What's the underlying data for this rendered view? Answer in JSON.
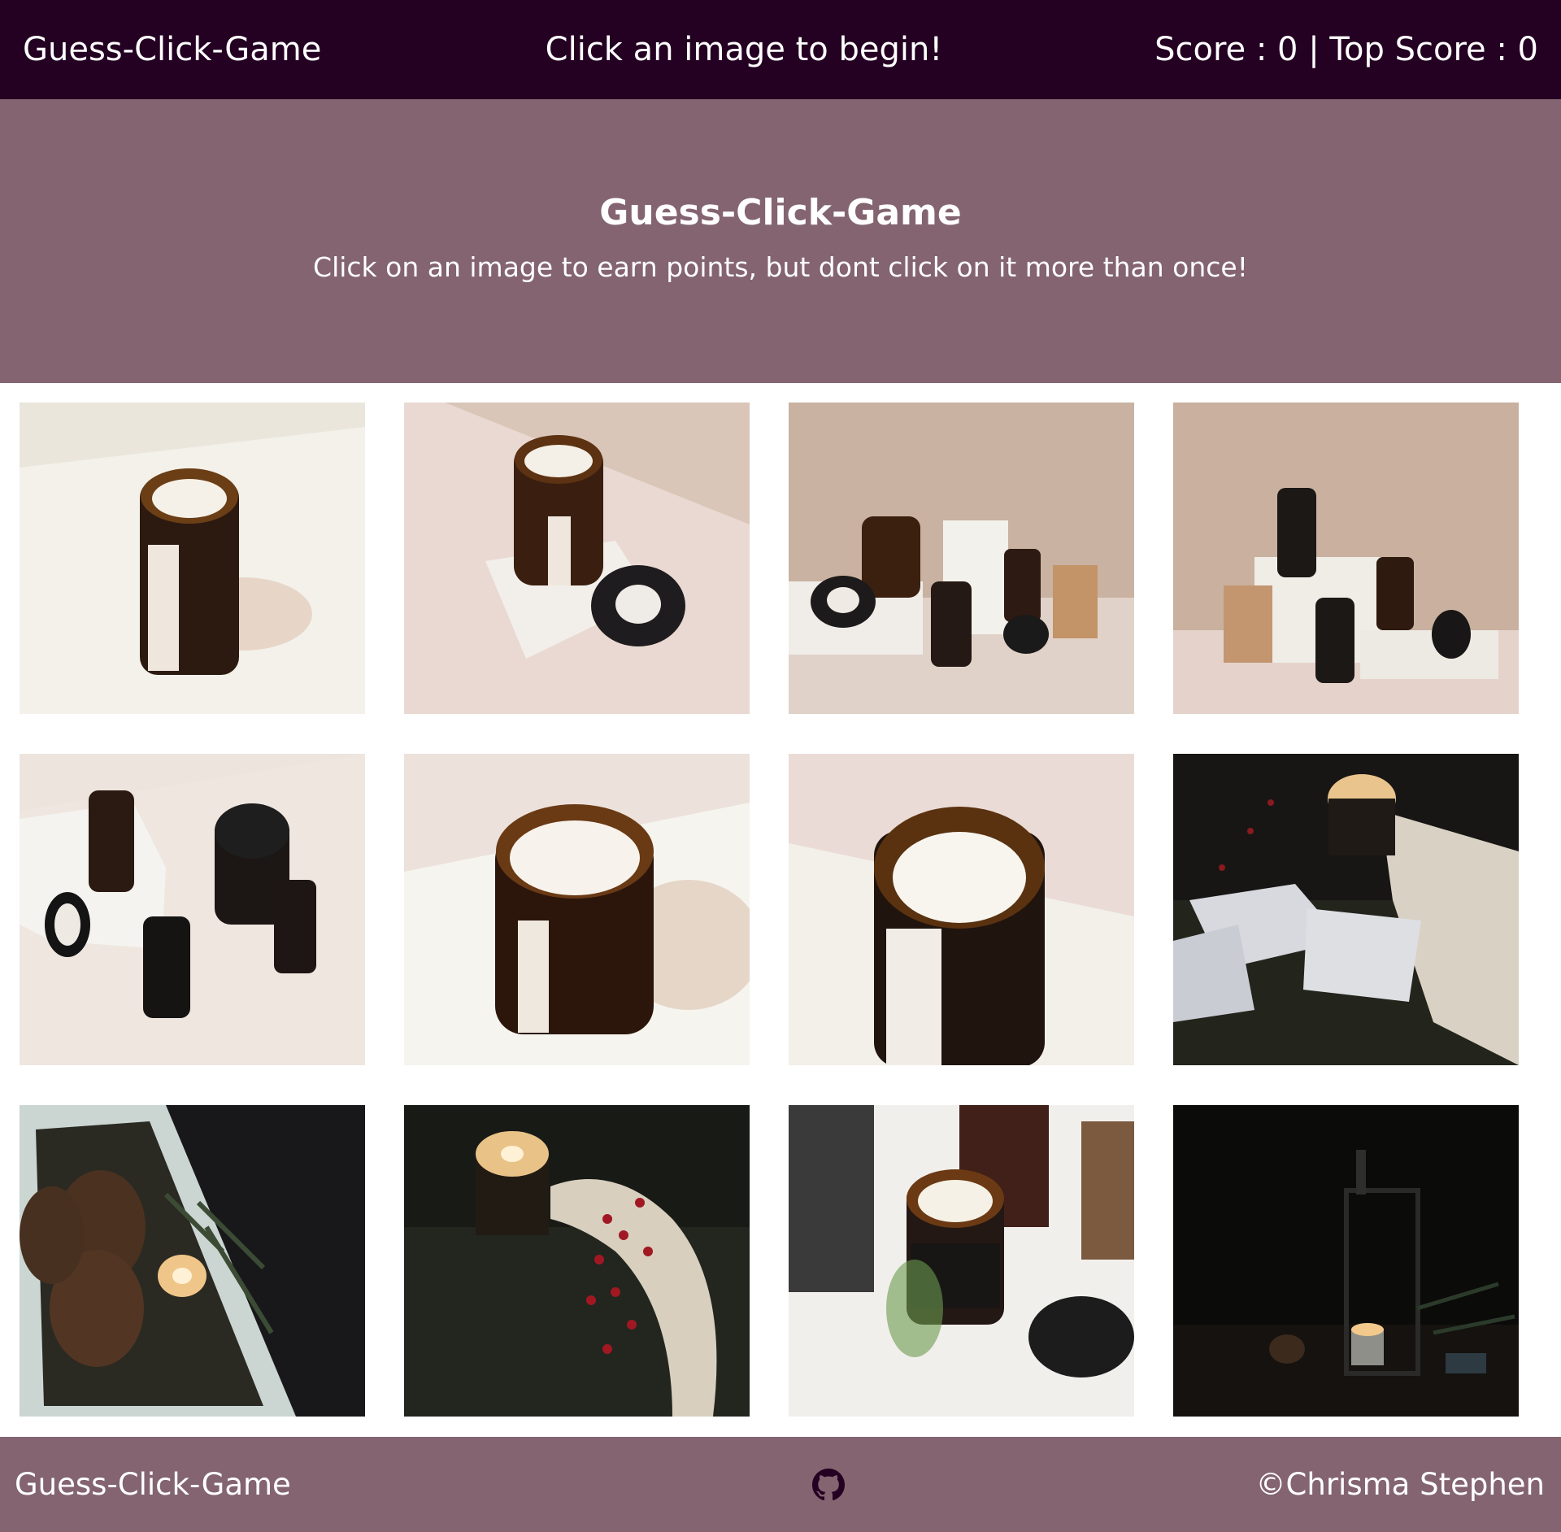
{
  "navbar": {
    "brand": "Guess-Click-Game",
    "message": "Click an image to begin!",
    "score": "Score : 0 | Top Score : 0"
  },
  "hero": {
    "title": "Guess-Click-Game",
    "subtitle": "Click on an image to earn points, but dont click on it more than once!"
  },
  "images": [
    {
      "id": 1,
      "description": "amber candle jar on cream surface"
    },
    {
      "id": 2,
      "description": "amber candle on white stone with black lid"
    },
    {
      "id": 3,
      "description": "candle product group with stones and boxes"
    },
    {
      "id": 4,
      "description": "black candle jars on white stone pedestals"
    },
    {
      "id": 5,
      "description": "black candle jars scattered on beige surface"
    },
    {
      "id": 6,
      "description": "large three-wick amber candle"
    },
    {
      "id": 7,
      "description": "close-up amber candle jar"
    },
    {
      "id": 8,
      "description": "lit candle with envelopes and knit blanket"
    },
    {
      "id": 9,
      "description": "lit candle with pine cones on ornate tray"
    },
    {
      "id": 10,
      "description": "lit candle with red berries and cream knit"
    },
    {
      "id": 11,
      "description": "amber candle with plant pot and black lid"
    },
    {
      "id": 12,
      "description": "lantern with candle in dark scene"
    }
  ],
  "footer": {
    "left": "Guess-Click-Game",
    "right": "©Chrisma Stephen",
    "icon": "github-icon"
  },
  "colors": {
    "navbar_bg": "#240022",
    "hero_bg": "#836470",
    "footer_bg": "#836470",
    "text": "#ffffff"
  }
}
